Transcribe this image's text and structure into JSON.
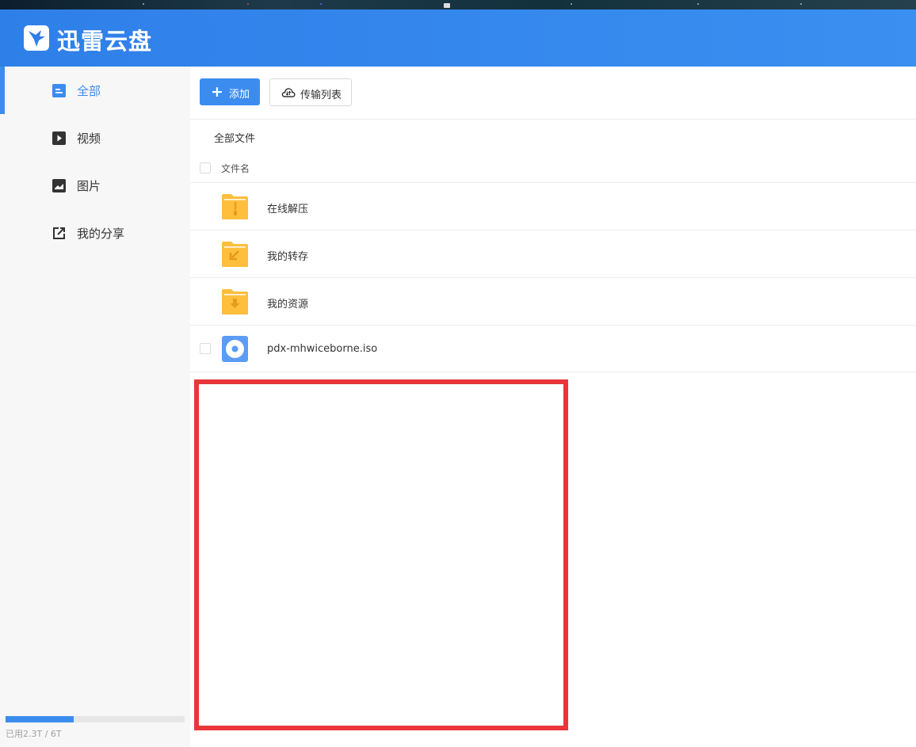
{
  "app": {
    "name": "迅雷云盘",
    "accent_color": "#3c8cf0",
    "header_color": "#2f7fe9"
  },
  "sidebar": {
    "items": [
      {
        "label": "全部",
        "icon": "file-list-icon",
        "active": true
      },
      {
        "label": "视频",
        "icon": "video-play-icon",
        "active": false
      },
      {
        "label": "图片",
        "icon": "image-icon",
        "active": false
      },
      {
        "label": "我的分享",
        "icon": "share-external-icon",
        "active": false
      }
    ],
    "storage": {
      "label": "已用2.3T / 6T",
      "used_fraction": 0.38
    }
  },
  "toolbar": {
    "add_label": "添加",
    "transfer_label": "传输列表"
  },
  "breadcrumb": "全部文件",
  "file_list": {
    "column_name": "文件名",
    "files": [
      {
        "name": "在线解压",
        "icon": "zip-folder-icon"
      },
      {
        "name": "我的转存",
        "icon": "transfer-folder-icon"
      },
      {
        "name": "我的资源",
        "icon": "download-folder-icon"
      },
      {
        "name": "pdx-mhwiceborne.iso",
        "icon": "disc-image-icon"
      }
    ]
  },
  "annotation": {
    "color": "#e8363b"
  }
}
